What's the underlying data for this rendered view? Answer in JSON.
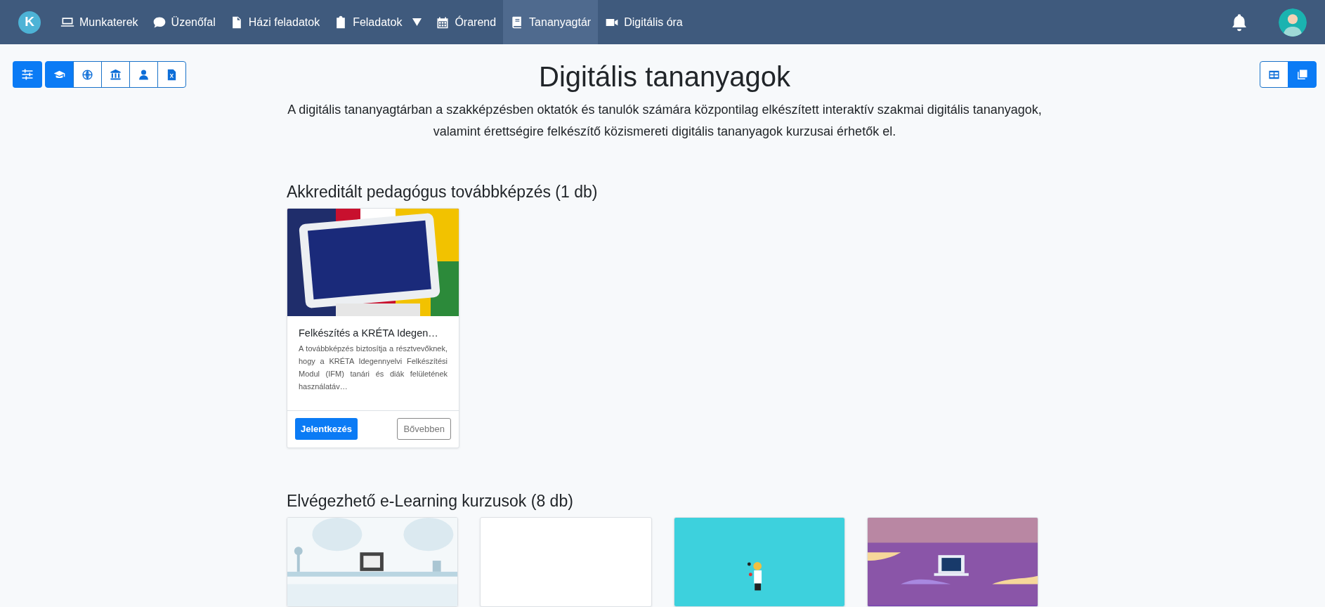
{
  "navbar": {
    "logo": "K",
    "items": [
      {
        "label": "Munkaterek",
        "kind": "laptop",
        "selected": false,
        "dropdown": false
      },
      {
        "label": "Üzenőfal",
        "kind": "chat",
        "selected": false,
        "dropdown": false
      },
      {
        "label": "Házi feladatok",
        "kind": "file",
        "selected": false,
        "dropdown": false
      },
      {
        "label": "Feladatok",
        "kind": "clipboard",
        "selected": false,
        "dropdown": true
      },
      {
        "label": "Órarend",
        "kind": "calendar",
        "selected": false,
        "dropdown": false
      },
      {
        "label": "Tananyagtár",
        "kind": "book",
        "selected": true,
        "dropdown": false
      },
      {
        "label": "Digitális óra",
        "kind": "video",
        "selected": false,
        "dropdown": false
      }
    ]
  },
  "filter_button": {
    "selected": true
  },
  "category_buttons": [
    {
      "kind": "graduation",
      "selected": true
    },
    {
      "kind": "globe",
      "selected": false
    },
    {
      "kind": "institution",
      "selected": false
    },
    {
      "kind": "person",
      "selected": false
    },
    {
      "kind": "excel",
      "selected": false
    }
  ],
  "view_buttons": [
    {
      "kind": "table",
      "selected": false
    },
    {
      "kind": "cards",
      "selected": true
    }
  ],
  "title": "Digitális tananyagok",
  "description": "A digitális tananyagtárban a szakképzésben oktatók és tanulók számára központilag elkészített interaktív szakmai digitális tananyagok, valamint érettségire felkészítő közismereti digitális tananyagok kurzusai érhetők el.",
  "sections": [
    {
      "heading": "Akkreditált pedagógus továbbképzés (1 db)",
      "cards": [
        {
          "kind": "picture",
          "title": "Felkészítés a KRÉTA Idegen…",
          "text": "A továbbképzés biztosítja a résztvevőknek, hogy a KRÉTA Idegennyelvi Felkészítési Modul (IFM) tanári és diák felületének használatáv…",
          "buttons": [
            {
              "label": "Jelentkezés",
              "kind": "primary"
            },
            {
              "label": "Bővebben",
              "kind": "secondary"
            }
          ]
        }
      ]
    },
    {
      "heading": "Elvégezhető e-Learning kurzusok (8 db)",
      "cards": [
        {
          "kind": "picture"
        },
        {
          "kind": "blank"
        },
        {
          "kind": "picture"
        },
        {
          "kind": "picture"
        }
      ]
    }
  ]
}
